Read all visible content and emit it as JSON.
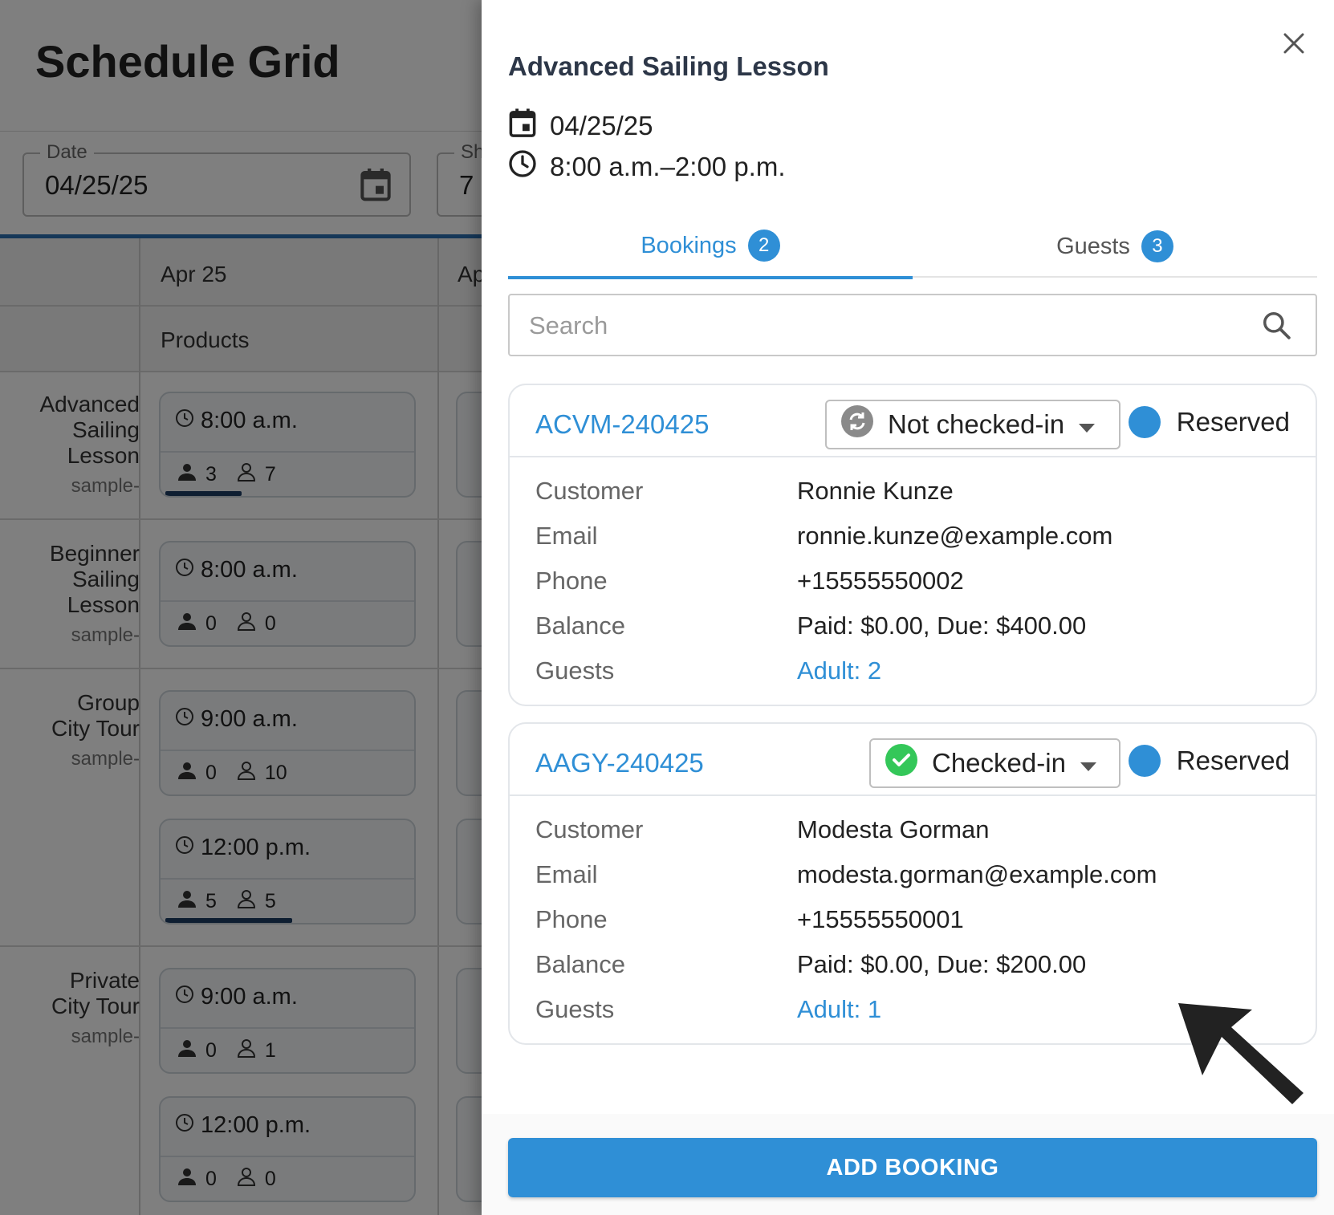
{
  "background": {
    "page_title": "Schedule Grid",
    "date_field": {
      "label": "Date",
      "value": "04/25/25"
    },
    "second_field": {
      "label": "Sh",
      "value": "7"
    },
    "grid": {
      "day_header": "Apr 25",
      "day_header_peek": "Ap",
      "products_header": "Products",
      "rows": [
        {
          "name_lines": [
            "Advanced",
            "Sailing",
            "Lesson"
          ],
          "sub": "sample-",
          "slots": [
            {
              "time": "8:00 a.m.",
              "booked": "3",
              "capacity": "7",
              "fill": 0.3
            }
          ]
        },
        {
          "name_lines": [
            "Beginner",
            "Sailing",
            "Lesson"
          ],
          "sub": "sample-",
          "slots": [
            {
              "time": "8:00 a.m.",
              "booked": "0",
              "capacity": "0",
              "fill": 0
            }
          ]
        },
        {
          "name_lines": [
            "Group",
            "City Tour"
          ],
          "sub": "sample-",
          "slots": [
            {
              "time": "9:00 a.m.",
              "booked": "0",
              "capacity": "10",
              "fill": 0
            },
            {
              "time": "12:00 p.m.",
              "booked": "5",
              "capacity": "5",
              "fill": 0.5
            }
          ]
        },
        {
          "name_lines": [
            "Private",
            "City Tour"
          ],
          "sub": "sample-",
          "slots": [
            {
              "time": "9:00 a.m.",
              "booked": "0",
              "capacity": "1",
              "fill": 0
            },
            {
              "time": "12:00 p.m.",
              "booked": "0",
              "capacity": "0",
              "fill": 0
            }
          ]
        }
      ]
    }
  },
  "drawer": {
    "title": "Advanced Sailing Lesson",
    "date": "04/25/25",
    "time_range": "8:00 a.m.–2:00 p.m.",
    "tabs": [
      {
        "label": "Bookings",
        "count": "2",
        "active": true
      },
      {
        "label": "Guests",
        "count": "3",
        "active": false
      }
    ],
    "search": {
      "placeholder": "Search",
      "value": ""
    },
    "field_labels": {
      "customer": "Customer",
      "email": "Email",
      "phone": "Phone",
      "balance": "Balance",
      "guests": "Guests"
    },
    "bookings": [
      {
        "code": "ACVM-240425",
        "checkin_status": "Not checked-in",
        "checkin_icon": "sync-icon",
        "state": "Reserved",
        "customer": "Ronnie Kunze",
        "email": "ronnie.kunze@example.com",
        "phone": "+15555550002",
        "balance": "Paid: $0.00, Due: $400.00",
        "guests": "Adult: 2"
      },
      {
        "code": "AAGY-240425",
        "checkin_status": "Checked-in",
        "checkin_icon": "check-circle-icon",
        "state": "Reserved",
        "customer": "Modesta Gorman",
        "email": "modesta.gorman@example.com",
        "phone": "+15555550001",
        "balance": "Paid: $0.00, Due: $200.00",
        "guests": "Adult: 1"
      }
    ],
    "add_button": "ADD BOOKING"
  },
  "colors": {
    "accent": "#2f8fd6",
    "success": "#34c759",
    "overlay": "rgba(0,0,0,0.5)"
  }
}
